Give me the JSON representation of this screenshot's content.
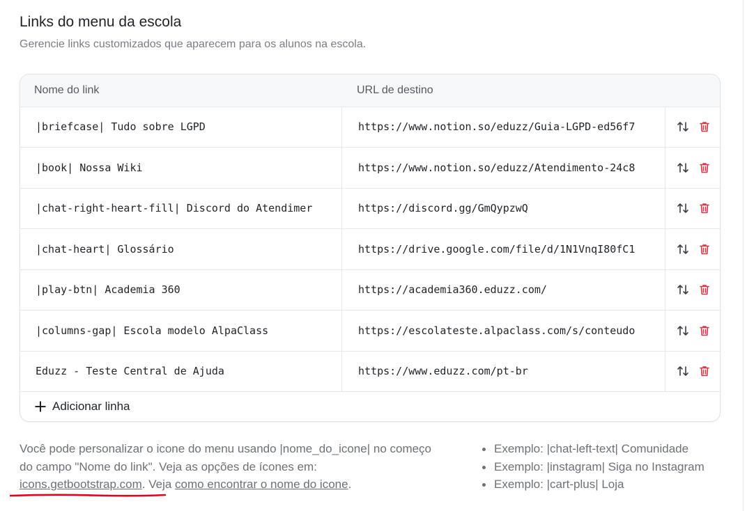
{
  "header": {
    "title": "Links do menu da escola",
    "subtitle": "Gerencie links customizados que aparecem para os alunos na escola."
  },
  "table": {
    "col_name": "Nome do link",
    "col_url": "URL de destino",
    "rows": [
      {
        "name": "|briefcase| Tudo sobre LGPD",
        "url": "https://www.notion.so/eduzz/Guia-LGPD-ed56f7"
      },
      {
        "name": "|book| Nossa Wiki",
        "url": "https://www.notion.so/eduzz/Atendimento-24c8"
      },
      {
        "name": "|chat-right-heart-fill| Discord do Atendimer",
        "url": "https://discord.gg/GmQypzwQ"
      },
      {
        "name": "|chat-heart| Glossário",
        "url": "https://drive.google.com/file/d/1N1VnqI80fC1"
      },
      {
        "name": "|play-btn| Academia 360",
        "url": "https://academia360.eduzz.com/"
      },
      {
        "name": "|columns-gap| Escola modelo AlpaClass",
        "url": "https://escolateste.alpaclass.com/s/conteudo"
      },
      {
        "name": "Eduzz - Teste Central de Ajuda",
        "url": "https://www.eduzz.com/pt-br"
      }
    ],
    "add_label": "Adicionar linha",
    "icons": {
      "sort": "arrow-down-up-icon",
      "delete": "trash-icon",
      "add": "plus-icon"
    },
    "delete_color": "#dc3545"
  },
  "help": {
    "text1": "Você pode personalizar o icone do menu usando |nome_do_icone| no começo do campo \"Nome do link\". Veja as opções de ícones em: ",
    "link1": "icons.getbootstrap.com",
    "text2": ". Veja ",
    "link2": "como encontrar o nome do icone",
    "text3": "."
  },
  "examples": [
    "Exemplo: |chat-left-text| Comunidade",
    "Exemplo: |instagram| Siga no Instagram",
    "Exemplo: |cart-plus| Loja"
  ],
  "annotation_color": "#e3001b"
}
